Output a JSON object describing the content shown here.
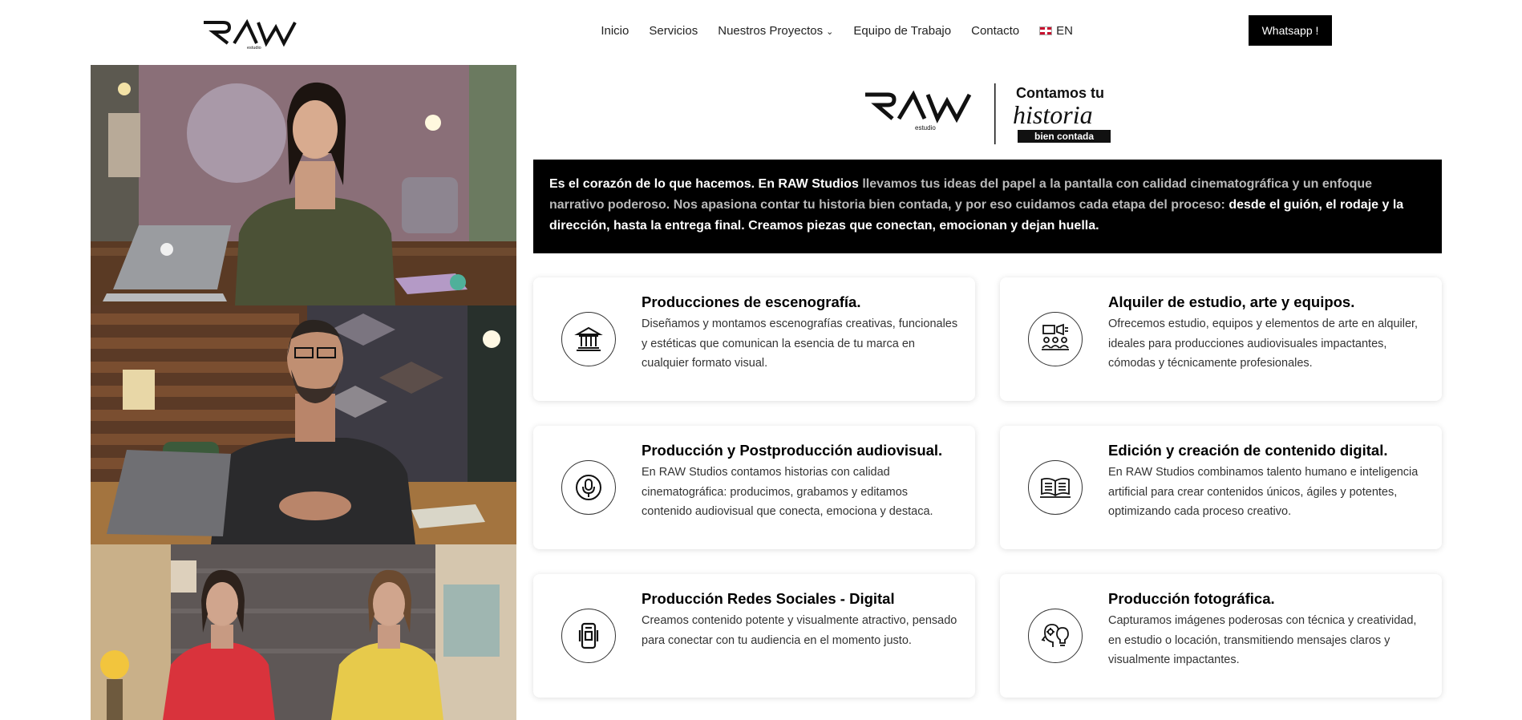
{
  "header": {
    "logo_text": "RAW",
    "logo_sub": "estudio",
    "nav": [
      {
        "label": "Inicio"
      },
      {
        "label": "Servicios"
      },
      {
        "label": "Nuestros Proyectos"
      },
      {
        "label": "Equipo de Trabajo"
      },
      {
        "label": "Contacto"
      }
    ],
    "language": "EN",
    "whatsapp_label": "Whatsapp !"
  },
  "hero": {
    "logo_text": "RAW",
    "logo_sub": "estudio",
    "tagline_1": "Contamos tu",
    "tagline_2": "historia",
    "tagline_3": "bien contada"
  },
  "intro": {
    "part1": "Es el corazón de lo que hacemos. En RAW Studios",
    "part2": "llevamos tus ideas del papel a la pantalla con calidad cinematográfica y un enfoque narrativo poderoso. Nos apasiona contar tu historia bien contada, y por eso cuidamos cada etapa del proceso:",
    "part3": "desde el guión, el rodaje y la dirección, hasta la entrega final. Creamos piezas que conectan, emocionan y dejan huella."
  },
  "services": [
    {
      "icon": "building-icon",
      "title": "Producciones de escenografía.",
      "description": "Diseñamos y montamos escenografías creativas, funcionales y estéticas que comunican la esencia de tu marca en cualquier formato visual."
    },
    {
      "icon": "presenter-audience-icon",
      "title": "Alquiler de estudio, arte y equipos.",
      "description": "Ofrecemos estudio, equipos y elementos de arte en alquiler, ideales para producciones audiovisuales impactantes, cómodas y técnicamente profesionales."
    },
    {
      "icon": "microphone-icon",
      "title": "Producción y Postproducción audiovisual.",
      "description": "En RAW Studios contamos historias con calidad cinematográfica: producimos, grabamos y editamos contenido audiovisual que conecta, emociona y destaca."
    },
    {
      "icon": "open-book-icon",
      "title": "Edición y creación de contenido digital.",
      "description": "En RAW Studios combinamos talento humano e inteligencia artificial para crear contenidos únicos, ágiles y potentes, optimizando cada proceso creativo."
    },
    {
      "icon": "smartphone-icon",
      "title": "Producción Redes Sociales - Digital",
      "description": "Creamos contenido potente y visualmente atractivo, pensado para conectar con tu audiencia en el momento justo."
    },
    {
      "icon": "head-lightbulb-icon",
      "title": "Producción fotográfica.",
      "description": "Capturamos imágenes poderosas con técnica y creatividad, en estudio o locación, transmitiendo mensajes claros y visualmente impactantes."
    }
  ],
  "colors": {
    "accent": "#000000",
    "banner_text_gray": "#b9b9b9"
  }
}
